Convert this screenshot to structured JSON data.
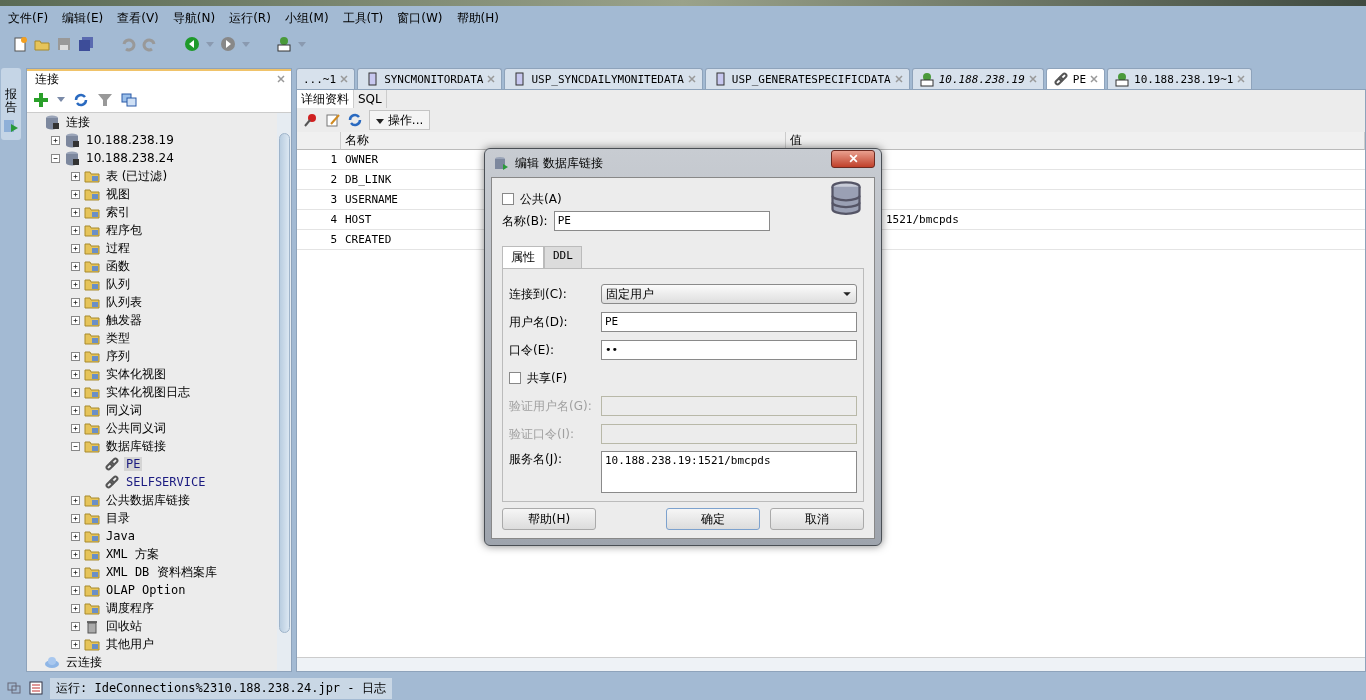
{
  "menu": [
    "文件(F)",
    "编辑(E)",
    "查看(V)",
    "导航(N)",
    "运行(R)",
    "小组(M)",
    "工具(T)",
    "窗口(W)",
    "帮助(H)"
  ],
  "side_tab": {
    "label": "报告"
  },
  "connections_panel": {
    "title": "连接",
    "tree": [
      {
        "label": "连接",
        "kind": "connections",
        "selected": false,
        "children": [
          {
            "label": "10.188.238.19",
            "kind": "connection",
            "selected": false,
            "expanded": false
          },
          {
            "label": "10.188.238.24",
            "kind": "connection",
            "selected": false,
            "expanded": true,
            "children": [
              {
                "label": "表 (已过滤)",
                "kind": "folder",
                "selected": false,
                "expanded": false
              },
              {
                "label": "视图",
                "kind": "folder",
                "selected": false,
                "expanded": false
              },
              {
                "label": "索引",
                "kind": "folder",
                "selected": false,
                "expanded": false
              },
              {
                "label": "程序包",
                "kind": "folder",
                "selected": false,
                "expanded": false
              },
              {
                "label": "过程",
                "kind": "folder",
                "selected": false,
                "expanded": false
              },
              {
                "label": "函数",
                "kind": "folder",
                "selected": false,
                "expanded": false
              },
              {
                "label": "队列",
                "kind": "folder",
                "selected": false,
                "expanded": false
              },
              {
                "label": "队列表",
                "kind": "folder",
                "selected": false,
                "expanded": false
              },
              {
                "label": "触发器",
                "kind": "folder",
                "selected": false,
                "expanded": false
              },
              {
                "label": "类型",
                "kind": "folder",
                "selected": false
              },
              {
                "label": "序列",
                "kind": "folder",
                "selected": false,
                "expanded": false
              },
              {
                "label": "实体化视图",
                "kind": "folder",
                "selected": false,
                "expanded": false
              },
              {
                "label": "实体化视图日志",
                "kind": "folder",
                "selected": false,
                "expanded": false
              },
              {
                "label": "同义词",
                "kind": "folder",
                "selected": false,
                "expanded": false
              },
              {
                "label": "公共同义词",
                "kind": "folder",
                "selected": false,
                "expanded": false
              },
              {
                "label": "数据库链接",
                "kind": "folder",
                "selected": false,
                "expanded": true,
                "children": [
                  {
                    "label": "PE",
                    "kind": "link",
                    "selected": true
                  },
                  {
                    "label": "SELFSERVICE",
                    "kind": "link",
                    "selected": false
                  }
                ]
              },
              {
                "label": "公共数据库链接",
                "kind": "folder",
                "selected": false,
                "expanded": false
              },
              {
                "label": "目录",
                "kind": "folder",
                "selected": false,
                "expanded": false
              },
              {
                "label": "Java",
                "kind": "folder",
                "selected": false,
                "expanded": false
              },
              {
                "label": "XML 方案",
                "kind": "folder",
                "selected": false,
                "expanded": false
              },
              {
                "label": "XML DB 资料档案库",
                "kind": "folder",
                "selected": false,
                "expanded": false
              },
              {
                "label": "OLAP Option",
                "kind": "folder",
                "selected": false,
                "expanded": false
              },
              {
                "label": "调度程序",
                "kind": "folder",
                "selected": false,
                "expanded": false
              },
              {
                "label": "回收站",
                "kind": "trash",
                "selected": false,
                "expanded": false
              },
              {
                "label": "其他用户",
                "kind": "folder",
                "selected": false,
                "expanded": false
              }
            ]
          }
        ]
      },
      {
        "label": "云连接",
        "kind": "cloud",
        "selected": false
      }
    ]
  },
  "editor_tabs": [
    {
      "label": "...~1",
      "kind": "none",
      "selected": false,
      "italic": false
    },
    {
      "label": "SYNCMONITORDATA",
      "kind": "procedure",
      "selected": false,
      "italic": false
    },
    {
      "label": "USP_SYNCDAILYMONITEDATA",
      "kind": "procedure",
      "selected": false,
      "italic": false
    },
    {
      "label": "USP_GENERATESPECIFICDATA",
      "kind": "procedure",
      "selected": false,
      "italic": false
    },
    {
      "label": "10.188.238.19",
      "kind": "sql",
      "selected": false,
      "italic": true
    },
    {
      "label": "PE",
      "kind": "link",
      "selected": true,
      "italic": false
    },
    {
      "label": "10.188.238.19~1",
      "kind": "sql",
      "selected": false,
      "italic": false
    }
  ],
  "sub_tabs": [
    {
      "label": "详细资料",
      "selected": true
    },
    {
      "label": "SQL",
      "selected": false
    }
  ],
  "actions_button": "操作...",
  "table": {
    "columns": [
      "名称",
      "值"
    ],
    "rows": [
      {
        "num": "1",
        "name": "OWNER"
      },
      {
        "num": "2",
        "name": "DB_LINK"
      },
      {
        "num": "3",
        "name": "USERNAME"
      },
      {
        "num": "4",
        "name": "HOST",
        "value": "1521/bmcpds"
      },
      {
        "num": "5",
        "name": "CREATED"
      }
    ]
  },
  "dialog": {
    "title": "编辑 数据库链接",
    "public": {
      "label": "公共(A)",
      "checked": false
    },
    "name": {
      "label": "名称(B):",
      "value": "PE"
    },
    "tabs": [
      {
        "label": "属性",
        "selected": true
      },
      {
        "label": "DDL",
        "selected": false
      }
    ],
    "connect_to": {
      "label": "连接到(C):",
      "value": "固定用户"
    },
    "username": {
      "label": "用户名(D):",
      "value": "PE"
    },
    "password": {
      "label": "口令(E):",
      "value": "••"
    },
    "shared": {
      "label": "共享(F)",
      "checked": false
    },
    "auth_username": {
      "label": "验证用户名(G):",
      "disabled": true
    },
    "auth_password": {
      "label": "验证口令(I):",
      "disabled": true
    },
    "service": {
      "label": "服务名(J):",
      "value": "10.188.238.19:1521/bmcpds"
    },
    "buttons": [
      {
        "label": "帮助(H)",
        "kind": "help",
        "focused": false
      },
      {
        "label": "确定",
        "kind": "ok",
        "focused": true
      },
      {
        "label": "取消",
        "kind": "cancel",
        "focused": false
      }
    ]
  },
  "status_bar": {
    "text": "运行: IdeConnections%2310.188.238.24.jpr - 日志"
  }
}
